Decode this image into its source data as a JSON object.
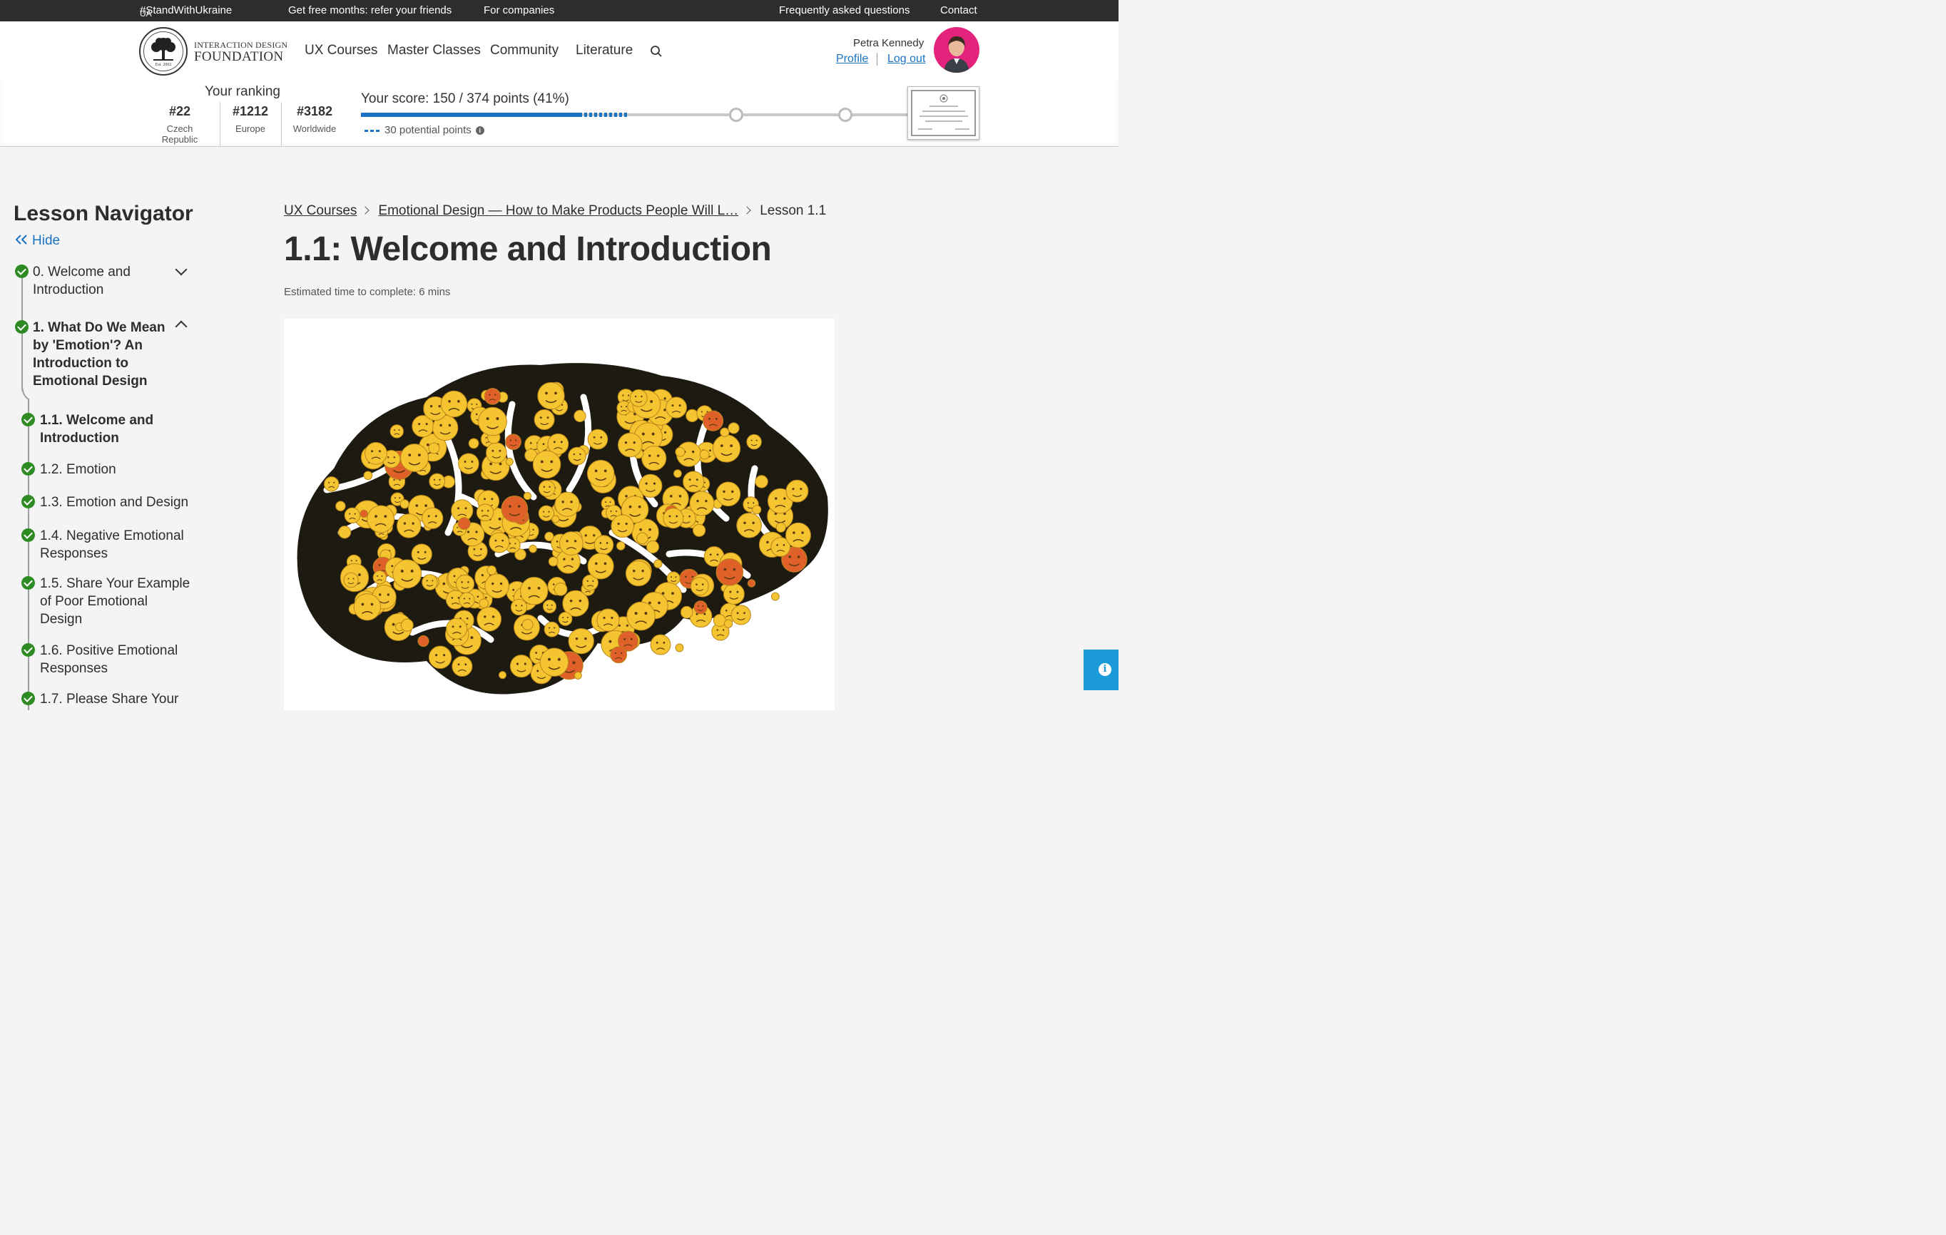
{
  "topbar": {
    "ukraine_flag": "UA",
    "ukraine": "#StandWithUkraine",
    "referral": "Get free months: refer your friends",
    "companies": "For companies",
    "faq": "Frequently asked questions",
    "contact": "Contact"
  },
  "header": {
    "brand_line1": "INTERACTION DESIGN",
    "brand_line2": "FOUNDATION",
    "logo_est": "Est. 2002",
    "nav": [
      "UX Courses",
      "Master Classes",
      "Community",
      "Literature"
    ],
    "user_name": "Petra Kennedy",
    "profile_label": "Profile",
    "logout_label": "Log out"
  },
  "ranking": {
    "title": "Your ranking",
    "items": [
      {
        "value": "#22",
        "label": "Czech Republic"
      },
      {
        "value": "#1212",
        "label": "Europe"
      },
      {
        "value": "#3182",
        "label": "Worldwide"
      }
    ],
    "score_text": "Your score: 150 / 374 points (41%)",
    "score_fraction": 0.41,
    "potential_text": "30 potential points",
    "accent": "#1a73c2"
  },
  "navigator": {
    "title": "Lesson Navigator",
    "hide_label": "Hide",
    "sections": [
      {
        "label": "0. Welcome and Introduction",
        "completed": true,
        "expanded": false
      },
      {
        "label": "1. What Do We Mean by 'Emotion'? An Introduction to Emotional Design",
        "completed": true,
        "expanded": true
      }
    ],
    "lessons": [
      {
        "label": "1.1. Welcome and Introduction",
        "current": true
      },
      {
        "label": "1.2. Emotion"
      },
      {
        "label": "1.3. Emotion and Design"
      },
      {
        "label": "1.4. Negative Emotional Responses"
      },
      {
        "label": "1.5. Share Your Example of Poor Emotional Design"
      },
      {
        "label": "1.6. Positive Emotional Responses"
      },
      {
        "label": "1.7. Please Share Your"
      }
    ],
    "check_color": "#2e8b23"
  },
  "main": {
    "breadcrumb": [
      "UX Courses",
      "Emotional Design — How to Make Products People Will L…",
      "Lesson 1.1"
    ],
    "title": "1.1: Welcome and Introduction",
    "estimated_time": "Estimated time to complete: 6 mins",
    "hero_image": "brain made of emoji faces"
  }
}
